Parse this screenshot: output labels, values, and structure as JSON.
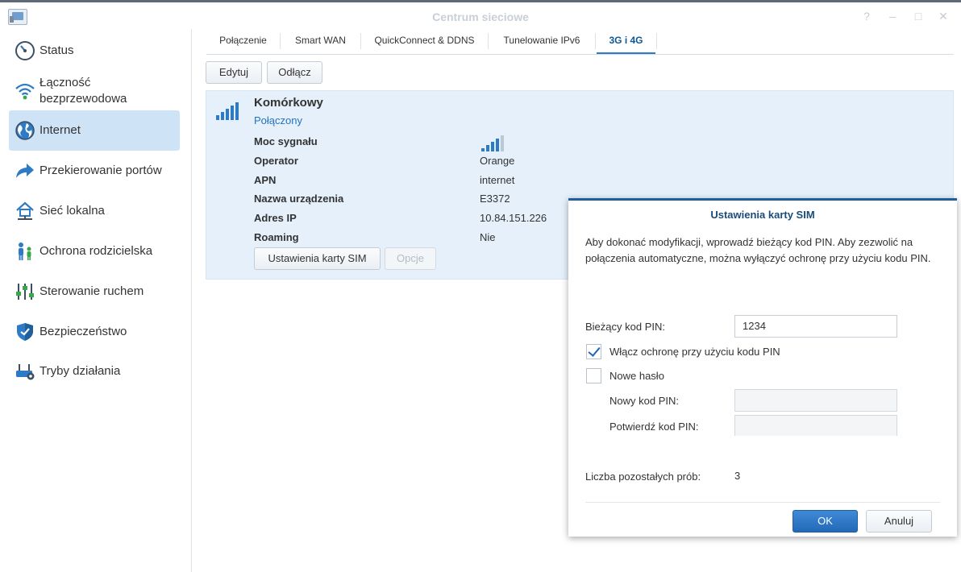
{
  "window": {
    "title": "Centrum sieciowe"
  },
  "colors": {
    "accent": "#2d7bc4",
    "sidebar_active": "#cfe3f7",
    "panel_bg": "#e5f0fb",
    "link": "#2174be",
    "primary_button": "#2369b8"
  },
  "sidebar": {
    "items": [
      {
        "label": "Status",
        "icon": "gauge-icon"
      },
      {
        "label": "Łączność bezprzewodowa",
        "icon": "wifi-icon"
      },
      {
        "label": "Internet",
        "icon": "globe-icon",
        "active": true
      },
      {
        "label": "Przekierowanie portów",
        "icon": "forward-arrow-icon"
      },
      {
        "label": "Sieć lokalna",
        "icon": "home-network-icon"
      },
      {
        "label": "Ochrona rodzicielska",
        "icon": "family-icon"
      },
      {
        "label": "Sterowanie ruchem",
        "icon": "sliders-icon"
      },
      {
        "label": "Bezpieczeństwo",
        "icon": "shield-icon"
      },
      {
        "label": "Tryby działania",
        "icon": "router-gear-icon"
      }
    ]
  },
  "tabs": [
    {
      "label": "Połączenie"
    },
    {
      "label": "Smart WAN"
    },
    {
      "label": "QuickConnect & DDNS"
    },
    {
      "label": "Tunelowanie IPv6"
    },
    {
      "label": "3G i 4G",
      "active": true
    }
  ],
  "toolbar": {
    "edit_label": "Edytuj",
    "disconnect_label": "Odłącz"
  },
  "connection": {
    "name": "Komórkowy",
    "status": "Połączony",
    "details": [
      {
        "label": "Moc sygnału",
        "value": ""
      },
      {
        "label": "Operator",
        "value": "Orange"
      },
      {
        "label": "APN",
        "value": "internet"
      },
      {
        "label": "Nazwa urządzenia",
        "value": "E3372"
      },
      {
        "label": "Adres IP",
        "value": "10.84.151.226"
      },
      {
        "label": "Roaming",
        "value": "Nie"
      }
    ],
    "signal_bars": 4,
    "signal_max": 5,
    "sim_button": "Ustawienia karty SIM",
    "options_button": "Opcje"
  },
  "dialog": {
    "title": "Ustawienia karty SIM",
    "description": "Aby dokonać modyfikacji, wprowadź bieżący kod PIN. Aby zezwolić na połączenia automatyczne, można wyłączyć ochronę przy użyciu kodu PIN.",
    "current_pin_label": "Bieżący kod PIN:",
    "current_pin_value": "1234",
    "enable_pin_label": "Włącz ochronę przy użyciu kodu PIN",
    "enable_pin_checked": true,
    "new_password_label": "Nowe hasło",
    "new_password_checked": false,
    "new_pin_label": "Nowy kod PIN:",
    "confirm_pin_label": "Potwierdź kod PIN:",
    "attempts_label": "Liczba pozostałych prób:",
    "attempts_value": "3",
    "ok_label": "OK",
    "cancel_label": "Anuluj"
  }
}
